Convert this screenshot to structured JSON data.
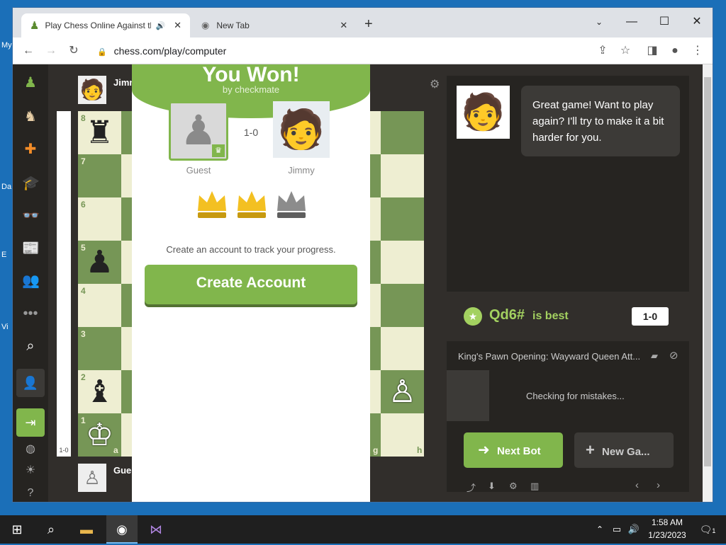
{
  "desktop": {
    "labels": [
      "My",
      "Da",
      "E",
      "Vi"
    ]
  },
  "browser": {
    "tabs": [
      {
        "title": "Play Chess Online Against th",
        "active": true
      },
      {
        "title": "New Tab",
        "active": false
      }
    ],
    "new_tab_symbol": "+",
    "url": "chess.com/play/computer"
  },
  "players": {
    "top_name": "Jimm",
    "bottom_name": "Gue"
  },
  "board": {
    "ranks": [
      "8",
      "7",
      "6",
      "5",
      "4",
      "3",
      "2",
      "1"
    ],
    "files_visible": [
      "a",
      "g",
      "h"
    ],
    "eval": "1-0"
  },
  "modal": {
    "title": "You Won!",
    "subtitle": "by checkmate",
    "score": "1-0",
    "left_player": "Guest",
    "right_player": "Jimmy",
    "message": "Create an account to track your progress.",
    "create_button": "Create Account"
  },
  "panel": {
    "bot_message": "Great game! Want to play again? I'll try to make it a bit harder for you.",
    "best_move": "Qd6#",
    "best_suffix": "is best",
    "result": "1-0",
    "opening": "King's Pawn Opening: Wayward Queen Att...",
    "checking": "Checking for mistakes...",
    "next_bot": "Next Bot",
    "new_game": "New Ga..."
  },
  "taskbar": {
    "time": "1:58 AM",
    "date": "1/23/2023",
    "notifications": "1"
  },
  "colors": {
    "green": "#81b64c",
    "dark": "#312e2b",
    "board_light": "#eeeed2",
    "board_dark": "#769656"
  }
}
